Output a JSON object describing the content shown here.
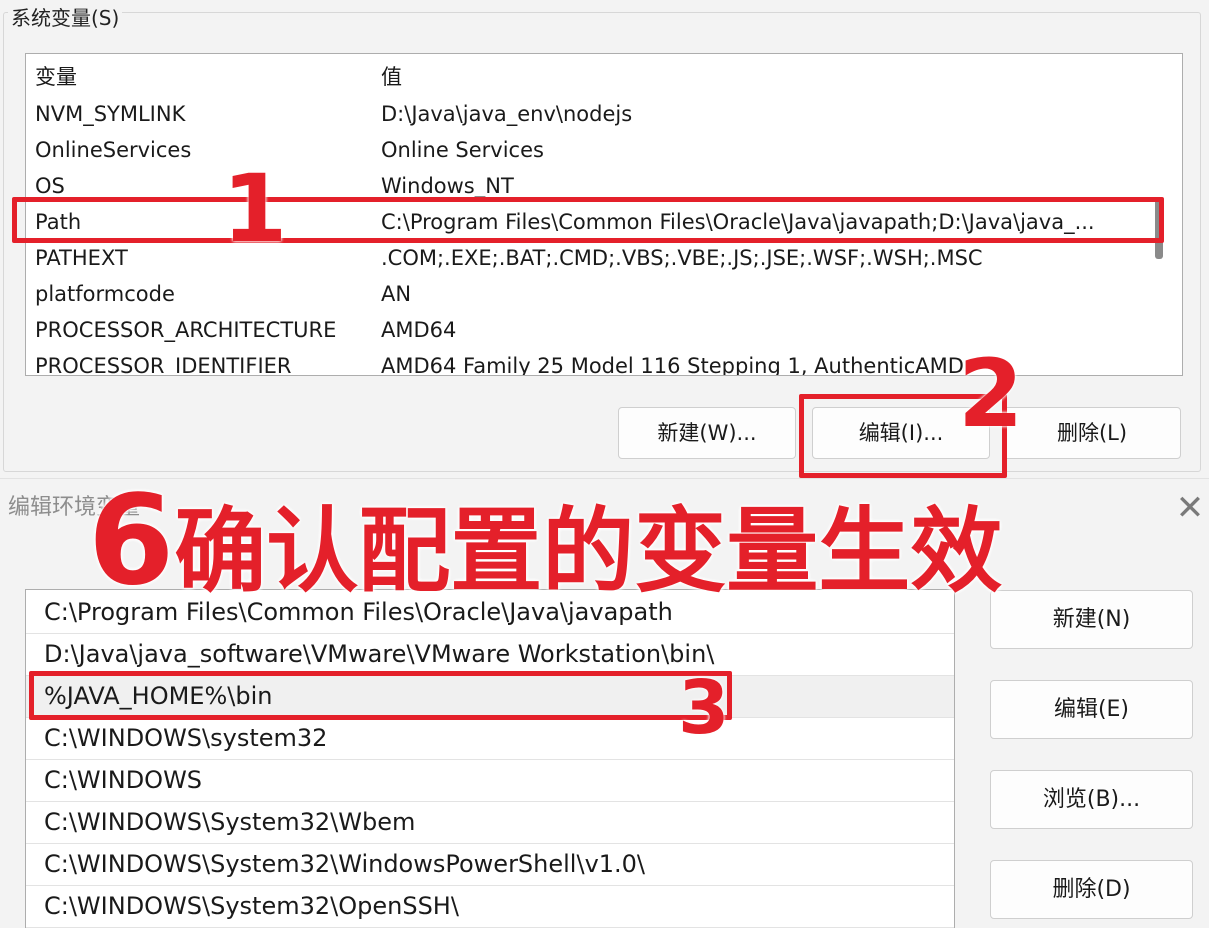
{
  "system_vars": {
    "group_label": "系统变量(S)",
    "headers": {
      "name": "变量",
      "value": "值"
    },
    "rows": [
      {
        "name": "NVM_SYMLINK",
        "value": "D:\\Java\\java_env\\nodejs"
      },
      {
        "name": "OnlineServices",
        "value": "Online Services"
      },
      {
        "name": "OS",
        "value": "Windows_NT"
      },
      {
        "name": "Path",
        "value": "C:\\Program Files\\Common Files\\Oracle\\Java\\javapath;D:\\Java\\java_..."
      },
      {
        "name": "PATHEXT",
        "value": ".COM;.EXE;.BAT;.CMD;.VBS;.VBE;.JS;.JSE;.WSF;.WSH;.MSC"
      },
      {
        "name": "platformcode",
        "value": "AN"
      },
      {
        "name": "PROCESSOR_ARCHITECTURE",
        "value": "AMD64"
      },
      {
        "name": "PROCESSOR_IDENTIFIER",
        "value": "AMD64 Family 25 Model 116 Stepping 1, AuthenticAMD"
      }
    ],
    "buttons": {
      "new": "新建(W)...",
      "edit": "编辑(I)...",
      "delete": "删除(L)"
    }
  },
  "edit_dialog": {
    "title": "编辑环境变量",
    "close_glyph": "✕",
    "paths": [
      "C:\\Program Files\\Common Files\\Oracle\\Java\\javapath",
      "D:\\Java\\java_software\\VMware\\VMware Workstation\\bin\\",
      "%JAVA_HOME%\\bin",
      "C:\\WINDOWS\\system32",
      "C:\\WINDOWS",
      "C:\\WINDOWS\\System32\\Wbem",
      "C:\\WINDOWS\\System32\\WindowsPowerShell\\v1.0\\",
      "C:\\WINDOWS\\System32\\OpenSSH\\"
    ],
    "selected_path": "%JAVA_HOME%\\bin",
    "buttons": {
      "new": "新建(N)",
      "edit": "编辑(E)",
      "browse": "浏览(B)...",
      "delete": "删除(D)"
    }
  },
  "annotations": {
    "step1": "1",
    "step2": "2",
    "step3": "3",
    "banner_number": "6",
    "banner_text": "确认配置的变量生效",
    "color": "#e4202a"
  }
}
